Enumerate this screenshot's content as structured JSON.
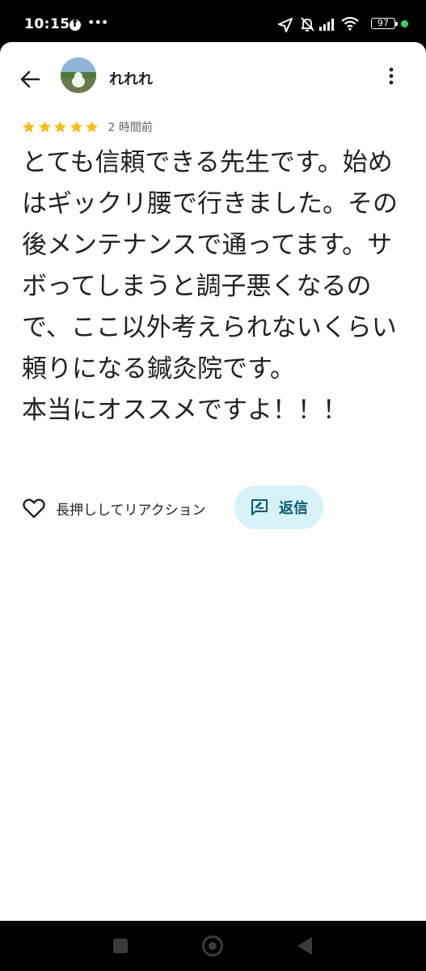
{
  "status_bar": {
    "time": "10:15",
    "battery_percent": "97",
    "icons": [
      "facebook-icon",
      "more-icon",
      "location-icon",
      "mute-icon",
      "signal-icon",
      "wifi-icon",
      "battery-icon",
      "charging-dot"
    ]
  },
  "header": {
    "user_name": "れれれ",
    "back_icon": "arrow-left-icon",
    "menu_icon": "more-vert-icon"
  },
  "review": {
    "rating": 5,
    "rating_max": 5,
    "time_ago": "2 時間前",
    "text": "とても信頼できる先生です。始めはギックリ腰で行きました。その後メンテナンスで通ってます。サボってしまうと調子悪くなるので、ここ以外考えられないくらい頼りになる鍼灸院です。\n本当にオススメですよ！！！"
  },
  "actions": {
    "like_label": "長押ししてリアクション",
    "reply_label": "返信"
  },
  "colors": {
    "star": "#f9bb16",
    "reply_bg": "#d7f2f8",
    "reply_text": "#0a5b73",
    "text": "#202124"
  }
}
